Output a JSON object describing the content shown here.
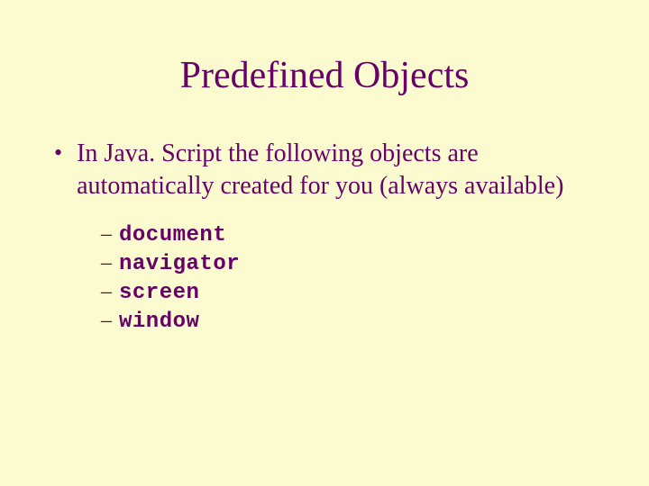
{
  "slide": {
    "title": "Predefined Objects",
    "bullet": "In Java. Script the following objects are automatically created for you (always available)",
    "subitems": {
      "0": "document",
      "1": "navigator",
      "2": "screen",
      "3": "window"
    }
  }
}
